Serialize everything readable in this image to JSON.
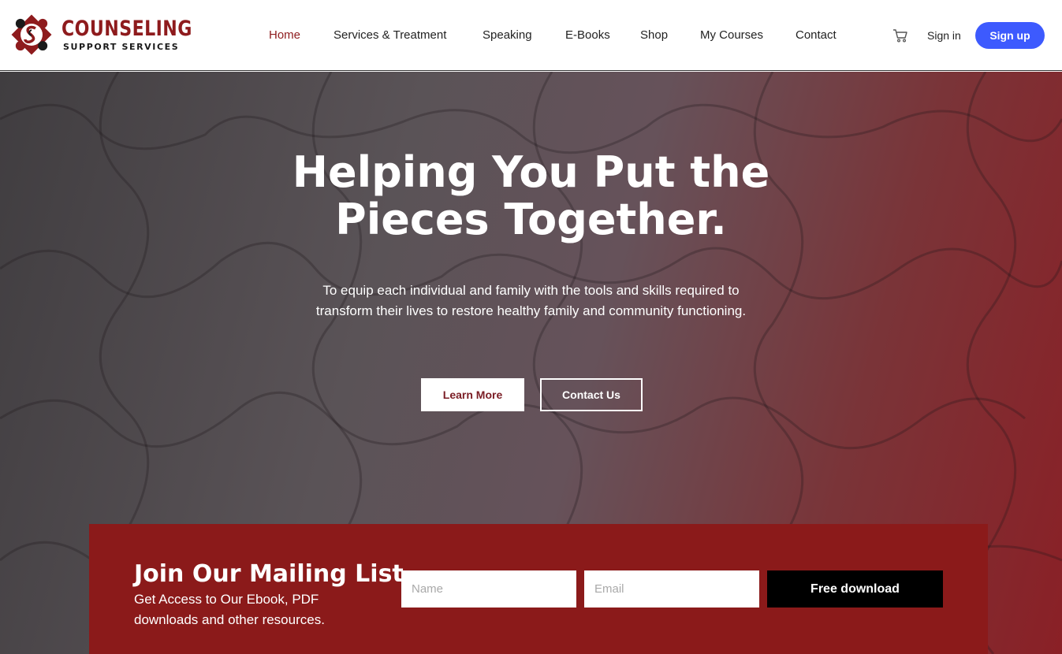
{
  "brand": {
    "title": "COUNSELING",
    "subtitle": "SUPPORT SERVICES",
    "primary_color": "#8e1b1d"
  },
  "nav": {
    "items": [
      {
        "label": "Home",
        "active": true
      },
      {
        "label": "Services & Treatment",
        "active": false
      },
      {
        "label": "Speaking",
        "active": false
      },
      {
        "label": "E-Books",
        "active": false
      },
      {
        "label": "Shop",
        "active": false
      },
      {
        "label": "My Courses",
        "active": false
      },
      {
        "label": "Contact",
        "active": false
      }
    ],
    "cart_icon": "shopping-cart-icon",
    "signin_label": "Sign in",
    "signup_label": "Sign up",
    "signup_color": "#3d5afe"
  },
  "hero": {
    "title": "Helping You Put the Pieces Together.",
    "subtitle": "To equip each individual and family with the tools and skills required to transform their lives to restore healthy family and community functioning.",
    "learn_more_label": "Learn More",
    "contact_label": "Contact Us"
  },
  "mailing": {
    "title": "Join Our Mailing List",
    "text": "Get Access to Our Ebook, PDF downloads and other resources.",
    "name_placeholder": "Name",
    "email_placeholder": "Email",
    "button_label": "Free download",
    "panel_color": "#8b1a1a"
  }
}
